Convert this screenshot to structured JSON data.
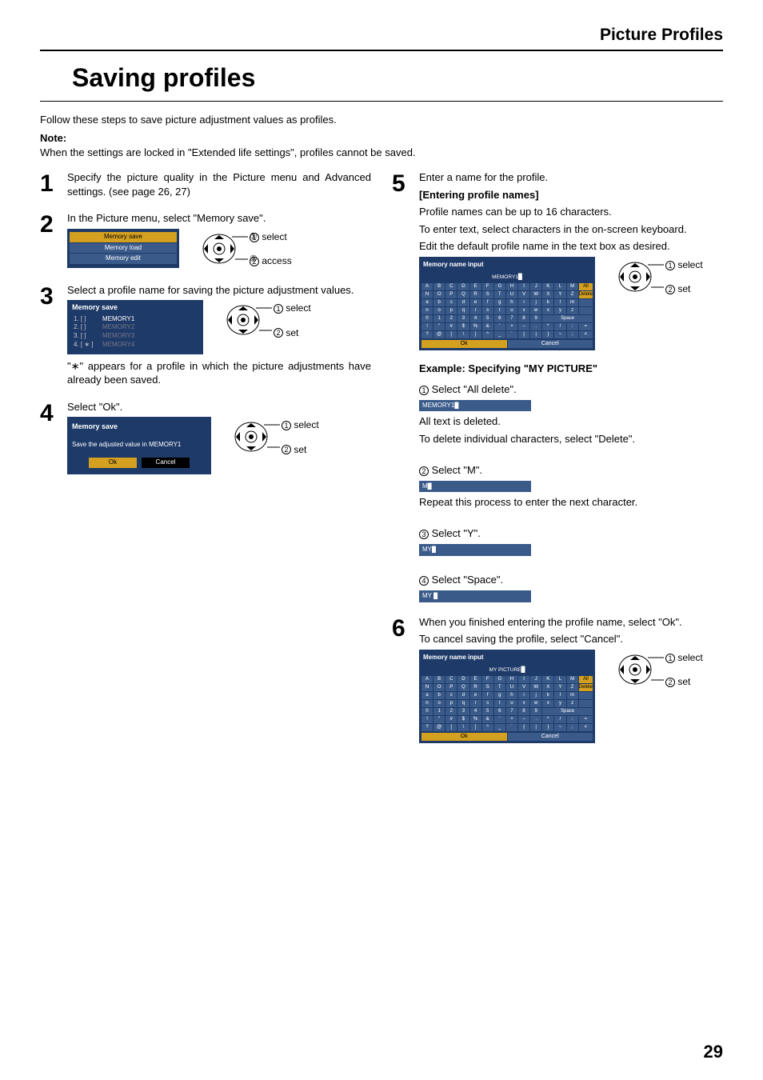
{
  "section_header": "Picture Profiles",
  "main_title": "Saving profiles",
  "intro": "Follow these steps to save picture adjustment values as profiles.",
  "note_label": "Note:",
  "note_text": "When the settings are locked in \"Extended life settings\", profiles cannot be saved.",
  "steps": {
    "1": "Specify the picture quality in the Picture menu and Advanced settings. (see page 26, 27)",
    "2": "In the Picture menu, select \"Memory save\".",
    "3": "Select a profile name for saving the picture adjustment values.",
    "3_after": "\"∗\" appears for a profile in which the picture adjustments have already been saved.",
    "4": "Select \"Ok\".",
    "5_line1": "Enter a name for the profile.",
    "5_sub": "[Entering profile names]",
    "5_line2": "Profile names can be up to 16 characters.",
    "5_line3": "To enter text, select characters in the on-screen keyboard.",
    "5_line4": "Edit the default profile name in the text box as desired.",
    "6_line1": "When you finished entering the profile name, select \"Ok\".",
    "6_line2": "To cancel saving the profile, select \"Cancel\"."
  },
  "menu_small": {
    "title": "",
    "items": [
      "Memory save",
      "Memory load",
      "Memory edit"
    ]
  },
  "mem_list": {
    "title": "Memory save",
    "rows": [
      {
        "n": "1. [    ]",
        "name": "MEMORY1"
      },
      {
        "n": "2. [    ]",
        "name": "MEMORY2"
      },
      {
        "n": "3. [    ]",
        "name": "MEMORY3"
      },
      {
        "n": "4. [ ∗ ]",
        "name": "MEMORY4"
      }
    ]
  },
  "confirm": {
    "title": "Memory save",
    "text": "Save the adjusted value in MEMORY1",
    "ok": "Ok",
    "cancel": "Cancel"
  },
  "kb": {
    "title": "Memory name input",
    "input1": "MEMORY1",
    "input2": "MY  PICTURE",
    "alldelete": "All delete",
    "delete": "Delete",
    "space": "Space",
    "ok": "Ok",
    "cancel": "Cancel",
    "rows": [
      [
        "A",
        "B",
        "C",
        "D",
        "E",
        "F",
        "G",
        "H",
        "I",
        "J",
        "K",
        "L",
        "M"
      ],
      [
        "N",
        "O",
        "P",
        "Q",
        "R",
        "S",
        "T",
        "U",
        "V",
        "W",
        "X",
        "Y",
        "Z"
      ],
      [
        "a",
        "b",
        "c",
        "d",
        "e",
        "f",
        "g",
        "h",
        "i",
        "j",
        "k",
        "l",
        "m"
      ],
      [
        "n",
        "o",
        "p",
        "q",
        "r",
        "s",
        "t",
        "u",
        "v",
        "w",
        "x",
        "y",
        "z"
      ],
      [
        "0",
        "1",
        "2",
        "3",
        "4",
        "5",
        "6",
        "7",
        "8",
        "9"
      ],
      [
        "!",
        "\"",
        "#",
        "$",
        "%",
        "&",
        "'",
        "+",
        "–",
        ".",
        "*",
        "/",
        ":",
        "="
      ],
      [
        "?",
        "@",
        "[",
        "\\",
        "]",
        "^",
        "_",
        "`",
        "{",
        "|",
        "}",
        "~",
        ";",
        "<",
        ">",
        "(",
        ")"
      ]
    ]
  },
  "remote_labels": {
    "select": "select",
    "access": "access",
    "set": "set"
  },
  "example": {
    "title": "Example: Specifying \"MY PICTURE\"",
    "s1": "Select \"All delete\".",
    "s1_strip": "MEMORY1",
    "s1_after1": "All text is deleted.",
    "s1_after2": "To delete individual characters, select \"Delete\".",
    "s2": "Select \"M\".",
    "s2_strip": "M",
    "s2_after": "Repeat this process to enter the next character.",
    "s3": "Select \"Y\".",
    "s3_strip": "MY",
    "s4": "Select \"Space\".",
    "s4_strip": "MY "
  },
  "page_number": "29"
}
